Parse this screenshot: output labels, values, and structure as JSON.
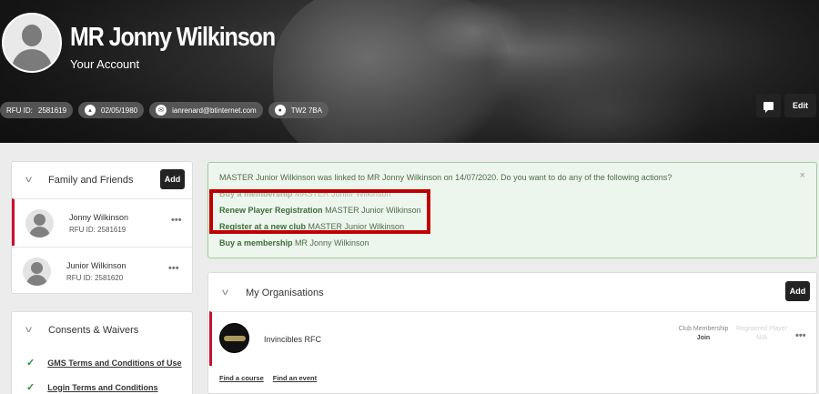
{
  "profile": {
    "name": "MR Jonny Wilkinson",
    "subtitle": "Your Account",
    "chips": {
      "rfu_label": "RFU ID:",
      "rfu_id": "2581619",
      "dob": "02/05/1980",
      "email": "ianrenard@btinternet.com",
      "postcode": "TW2 7BA"
    },
    "edit_label": "Edit"
  },
  "family": {
    "title": "Family and Friends",
    "add_label": "Add",
    "members": [
      {
        "name": "Jonny Wilkinson",
        "rfu": "RFU ID: 2581619"
      },
      {
        "name": "Junior Wilkinson",
        "rfu": "RFU ID: 2581620"
      }
    ]
  },
  "consents": {
    "title": "Consents & Waivers",
    "items": [
      {
        "label": "GMS Terms and Conditions of Use"
      },
      {
        "label": "Login Terms and Conditions"
      }
    ]
  },
  "alert": {
    "message": "MASTER Junior Wilkinson was linked to MR Jonny Wilkinson on 14/07/2020. Do you want to do any of the following actions?",
    "close": "×",
    "actions": [
      {
        "label": "Buy a membership",
        "target": "MASTER Junior Wilkinson"
      },
      {
        "label": "Renew Player Registration",
        "target": "MASTER Junior Wilkinson"
      },
      {
        "label": "Register at a new club",
        "target": "MASTER Junior Wilkinson"
      },
      {
        "label": "Buy a membership",
        "target": "MR Jonny Wilkinson"
      }
    ]
  },
  "organisations": {
    "title": "My Organisations",
    "add_label": "Add",
    "items": [
      {
        "name": "Invincibles RFC",
        "club_membership_label": "Club Membership",
        "club_membership_value": "Join",
        "registered_player_label": "Registered Player",
        "registered_player_value": "N/A"
      }
    ],
    "links": {
      "find_course": "Find a course",
      "find_event": "Find an event"
    }
  },
  "colors": {
    "accent_red": "#c8102e",
    "highlight_red": "#c00000",
    "success_bg": "#edf6ec",
    "success_text": "#4d6d4b",
    "dark_button": "#232323"
  }
}
